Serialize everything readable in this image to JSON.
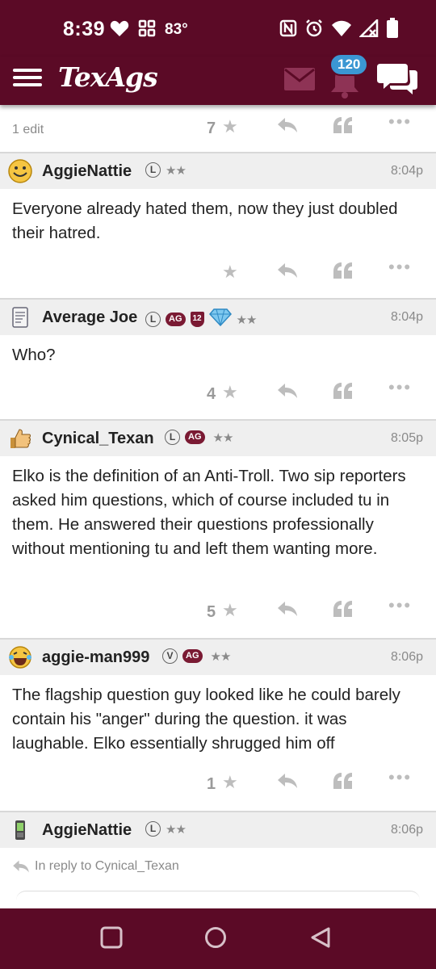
{
  "status_bar": {
    "time": "8:39",
    "temperature": "83°",
    "icons": [
      "heart-icon",
      "grid-icon",
      "nfc-icon",
      "alarm-icon",
      "wifi-icon",
      "signal-icon",
      "battery-icon"
    ]
  },
  "app_bar": {
    "logo": "TexAgs",
    "notification_count": "120",
    "icons": [
      "menu-icon",
      "mail-icon",
      "bell-icon",
      "chat-icon"
    ]
  },
  "top_actions": {
    "edit_note": "1 edit",
    "star_count": "7"
  },
  "posts": [
    {
      "username": "AggieNattie",
      "badges": [
        "L"
      ],
      "stars": "★★",
      "time": "8:04p",
      "body": "Everyone already hated them, now they just doubled their hatred.",
      "star_count": "",
      "avatar": "smiley-avatar"
    },
    {
      "username": "Average Joe",
      "badges": [
        "L",
        "AG",
        "12",
        "diamond"
      ],
      "stars": "★★",
      "time": "8:04p",
      "body": "Who?",
      "star_count": "4",
      "avatar": "notepad-avatar"
    },
    {
      "username": "Cynical_Texan",
      "badges": [
        "L",
        "AG"
      ],
      "stars": "★★",
      "time": "8:05p",
      "body": "Elko is the definition of an Anti-Troll. Two sip reporters asked him questions, which of course included tu in them. He answered their questions professionally without mentioning tu and left them wanting more.",
      "star_count": "5",
      "avatar": "thumbsup-avatar"
    },
    {
      "username": "aggie-man999",
      "badges": [
        "V",
        "AG"
      ],
      "stars": "★★",
      "time": "8:06p",
      "body": "The flagship question guy looked like he could barely contain his \"anger\" during the question. it was laughable. Elko essentially shrugged him off",
      "star_count": "1",
      "avatar": "laughing-avatar"
    },
    {
      "username": "AggieNattie",
      "badges": [
        "L"
      ],
      "stars": "★★",
      "time": "8:06p",
      "reply_note": "In reply to Cynical_Texan",
      "avatar": "phone-avatar"
    }
  ],
  "colors": {
    "maroon": "#5b0a26",
    "badge_blue": "#3b97d3",
    "header_gray": "#efefef"
  }
}
